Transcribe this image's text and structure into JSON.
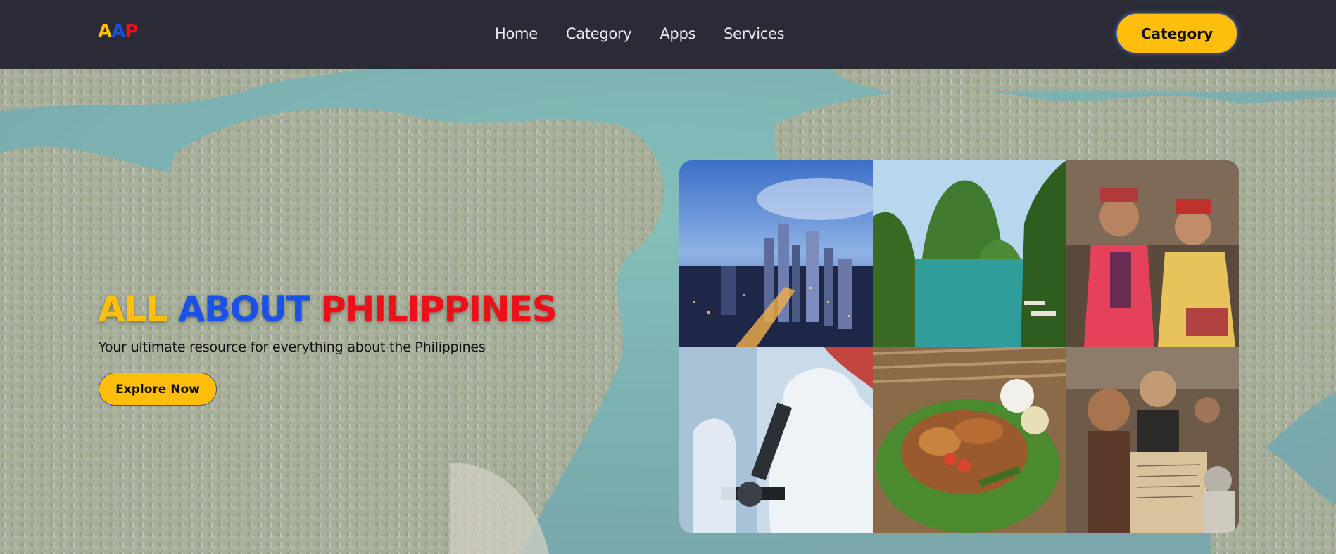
{
  "nav": {
    "logo_letters": [
      "A",
      "A",
      "P"
    ],
    "links": [
      "Home",
      "Category",
      "Apps",
      "Services"
    ],
    "cta_label": "Category"
  },
  "hero": {
    "title_words": [
      "ALL",
      "ABOUT",
      "PHILIPPINES"
    ],
    "subtitle": "Your ultimate resource for everything about the Philippines",
    "button_label": "Explore Now",
    "background": "aerial-karst-lagoon-image"
  },
  "collage": {
    "tiles": [
      "city-skyline-image",
      "karst-lagoon-image",
      "elders-portrait-image",
      "scientist-microscope-image",
      "filipino-feast-image",
      "heritage-collage-image"
    ]
  },
  "colors": {
    "nav_bg": "#2b2a37",
    "yellow": "#ffbe0b",
    "blue": "#1a51e6",
    "red": "#ee1018"
  }
}
